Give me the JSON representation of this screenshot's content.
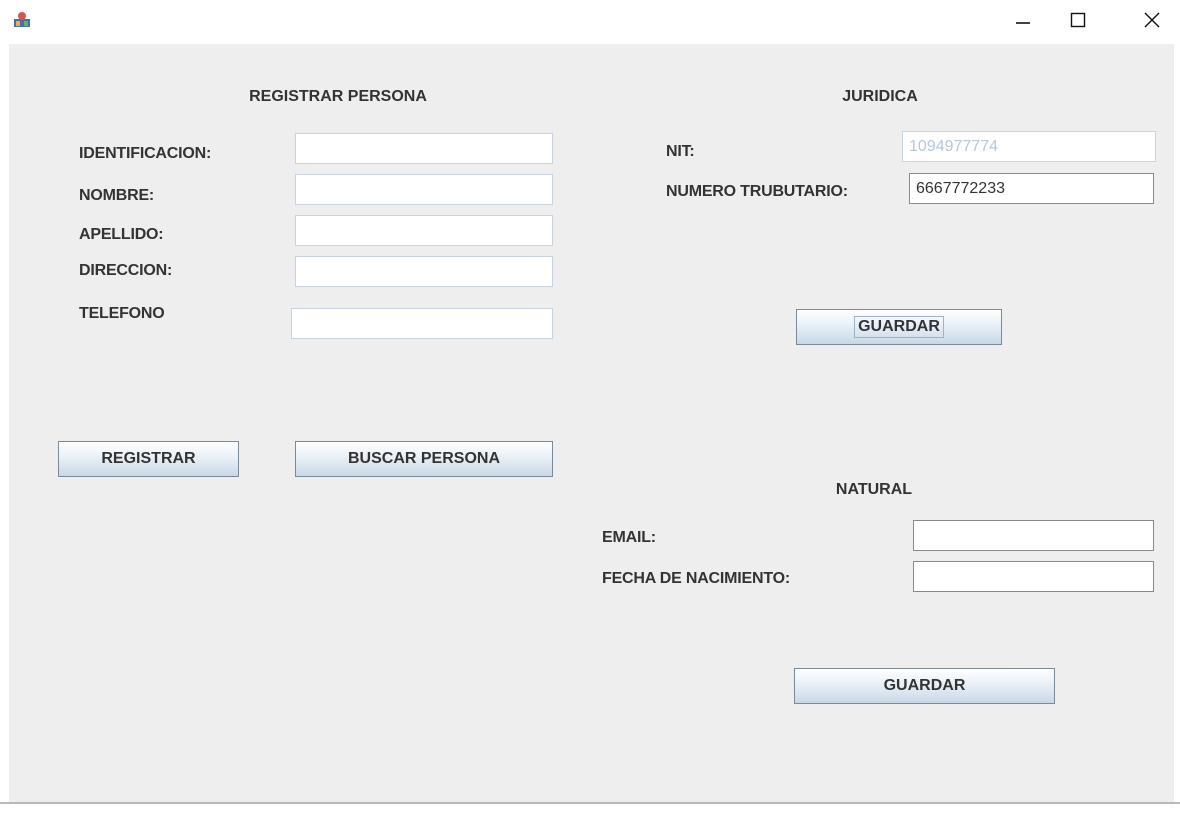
{
  "window": {
    "icon": "java-app-icon",
    "controls": [
      "minimize-icon",
      "maximize-icon",
      "close-icon"
    ]
  },
  "registrar_persona": {
    "title": "REGISTRAR PERSONA",
    "fields": [
      {
        "label": "IDENTIFICACION:",
        "value": ""
      },
      {
        "label": "NOMBRE:",
        "value": ""
      },
      {
        "label": "APELLIDO:",
        "value": ""
      },
      {
        "label": "DIRECCION:",
        "value": ""
      },
      {
        "label": "TELEFONO",
        "value": ""
      }
    ],
    "registrar_button": "REGISTRAR",
    "buscar_button": "BUSCAR PERSONA"
  },
  "juridica": {
    "title": "JURIDICA",
    "nit_label": "NIT:",
    "nit_value": "1094977774",
    "numero_label": "NUMERO TRUBUTARIO:",
    "numero_value": "6667772233",
    "guardar_button": "GUARDAR"
  },
  "natural": {
    "title": "NATURAL",
    "email_label": "EMAIL:",
    "email_value": "",
    "fecha_label": "FECHA DE NACIMIENTO:",
    "fecha_value": "",
    "guardar_button": "GUARDAR"
  },
  "colors": {
    "panel_background": "#eeeeee",
    "label_text": "#333333",
    "disabled_text": "#b5c8dc",
    "button_gradient_bottom": "#c9d8e6"
  }
}
